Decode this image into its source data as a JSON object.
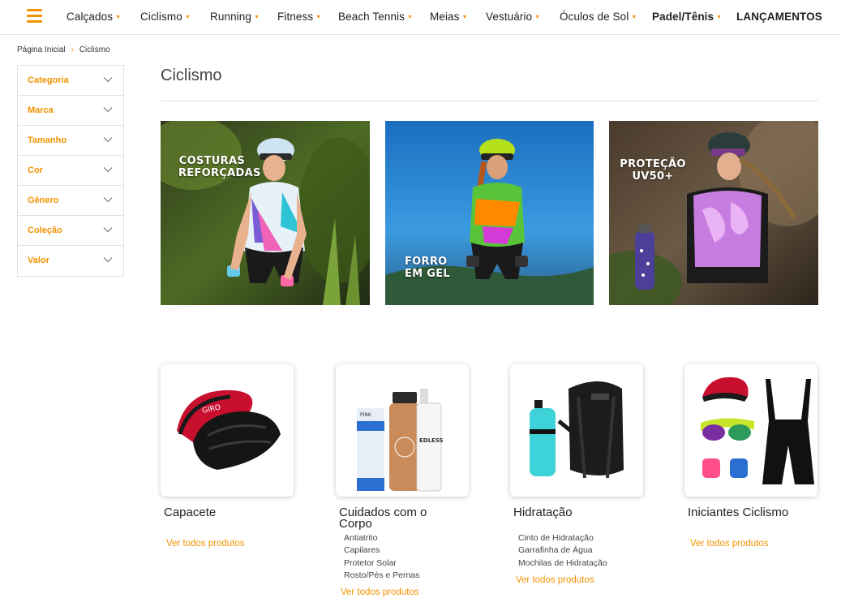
{
  "nav": {
    "menu_icon": "hamburger-menu-icon",
    "items": [
      {
        "label": "Calçados"
      },
      {
        "label": "Ciclismo"
      },
      {
        "label": "Running"
      },
      {
        "label": "Fitness"
      },
      {
        "label": "Beach Tennis"
      },
      {
        "label": "Meias"
      },
      {
        "label": "Vestuário"
      },
      {
        "label": "Óculos de Sol"
      },
      {
        "label": "Padel/Tênis"
      },
      {
        "label": "LANÇAMENTOS"
      }
    ]
  },
  "breadcrumb": {
    "home": "Página Inicial",
    "separator": "›",
    "current": "Ciclismo"
  },
  "filters": [
    {
      "label": "Categoria"
    },
    {
      "label": "Marca"
    },
    {
      "label": "Tamanho"
    },
    {
      "label": "Cor"
    },
    {
      "label": "Gênero"
    },
    {
      "label": "Coleção"
    },
    {
      "label": "Valor"
    }
  ],
  "page_title": "Ciclismo",
  "banners": [
    {
      "text_line1": "COSTURAS",
      "text_line2": "REFORÇADAS"
    },
    {
      "text_line1": "FORRO",
      "text_line2": "EM GEL"
    },
    {
      "text_line1": "PROTEÇÃO",
      "text_line2": "UV50+"
    }
  ],
  "categories": [
    {
      "name": "Capacete",
      "subcategories": [],
      "see_all": "Ver todos produtos"
    },
    {
      "name": "Cuidados com o Corpo",
      "subcategories": [
        "Antiatrito",
        "Capilares",
        "Protetor Solar",
        "Rosto/Pés e Pernas"
      ],
      "see_all": "Ver todos produtos"
    },
    {
      "name": "Hidratação",
      "subcategories": [
        "Cinto de Hidratação",
        "Garrafinha de Água",
        "Mochilas de Hidratação"
      ],
      "see_all": "Ver todos produtos"
    },
    {
      "name": "Iniciantes Ciclismo",
      "subcategories": [],
      "see_all": "Ver todos produtos"
    }
  ],
  "colors": {
    "accent": "#f39200",
    "text": "#222222"
  }
}
